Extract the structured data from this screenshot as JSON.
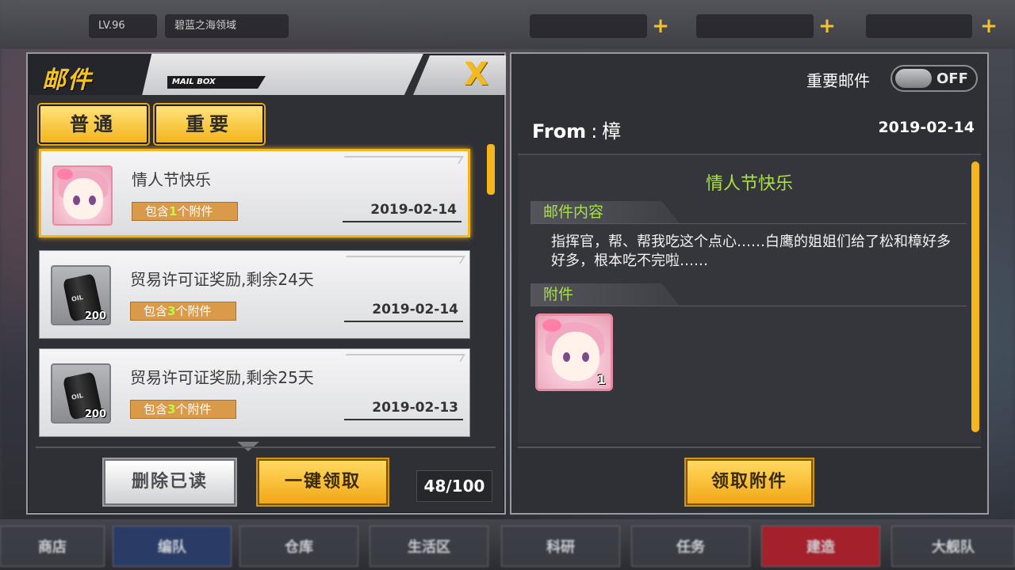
{
  "top_bar": {
    "chip_1": "LV.96",
    "chip_2": "碧蓝之海领域"
  },
  "left_panel": {
    "title": "邮件",
    "mailbox_tag": "MAIL BOX",
    "close": "X",
    "tabs": [
      {
        "label": "普通"
      },
      {
        "label": "重要"
      }
    ],
    "mails": [
      {
        "subject": "情人节快乐",
        "attach_prefix": "包含",
        "attach_count": "1",
        "attach_suffix": "个附件",
        "date": "2019-02-14",
        "icon": "character-portrait-icon",
        "selected": true
      },
      {
        "subject": "贸易许可证奖励,剩余24天",
        "attach_prefix": "包含",
        "attach_count": "3",
        "attach_suffix": "个附件",
        "date": "2019-02-14",
        "icon": "oil-barrel-icon",
        "icon_text": "OIL",
        "qty": "200"
      },
      {
        "subject": "贸易许可证奖励,剩余25天",
        "attach_prefix": "包含",
        "attach_count": "3",
        "attach_suffix": "个附件",
        "date": "2019-02-13",
        "icon": "oil-barrel-icon",
        "icon_text": "OIL",
        "qty": "200"
      }
    ],
    "delete_read_label": "删除已读",
    "claim_all_label": "一键领取",
    "mail_count": "48/100"
  },
  "right_panel": {
    "important_label": "重要邮件",
    "toggle_text": "OFF",
    "from_label": "From",
    "from_colon": ":",
    "from_name": "樟",
    "date": "2019-02-14",
    "subject": "情人节快乐",
    "content_heading": "邮件内容",
    "body": "指挥官，帮、帮我吃这个点心……白鹰的姐姐们给了松和樟好多好多，根本吃不完啦……",
    "attachments_heading": "附件",
    "attachment_qty": "1",
    "claim_label": "领取附件"
  },
  "bottom_nav": [
    {
      "label": "商店",
      "icon": "shop-icon"
    },
    {
      "label": "编队",
      "icon": "formation-icon"
    },
    {
      "label": "仓库",
      "icon": "depot-icon"
    },
    {
      "label": "生活区",
      "icon": "dorm-icon"
    },
    {
      "label": "科研",
      "icon": "gear-icon"
    },
    {
      "label": "任务",
      "icon": "mission-icon"
    },
    {
      "label": "建造",
      "icon": "build-icon"
    },
    {
      "label": "大舰队",
      "icon": "fleet-icon"
    }
  ],
  "colors": {
    "accent_yellow": "#f4b51d",
    "subject_green": "#a9e04a",
    "panel_bg": "#2f3036"
  }
}
